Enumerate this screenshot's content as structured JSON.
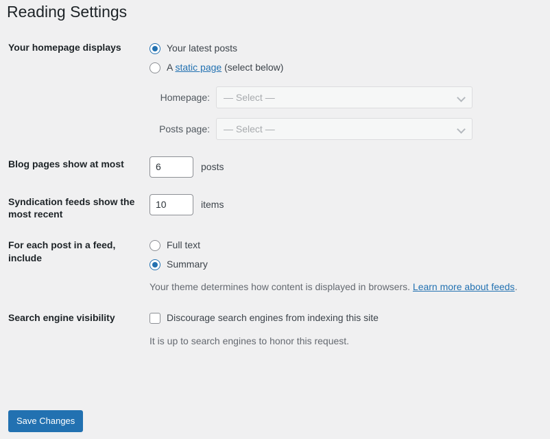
{
  "page": {
    "title": "Reading Settings"
  },
  "homepage_section": {
    "label": "Your homepage displays",
    "options": [
      {
        "label": "Your latest posts",
        "selected": true
      },
      {
        "label_prefix": "A ",
        "link_text": "static page",
        "label_suffix": " (select below)",
        "selected": false
      }
    ],
    "static_rows": [
      {
        "label": "Homepage:",
        "value": "— Select —",
        "disabled": true
      },
      {
        "label": "Posts page:",
        "value": "— Select —",
        "disabled": true
      }
    ]
  },
  "blog_pages_section": {
    "label": "Blog pages show at most",
    "value": "6",
    "unit": "posts"
  },
  "syndication_section": {
    "label": "Syndication feeds show the most recent",
    "value": "10",
    "unit": "items"
  },
  "feed_include_section": {
    "label": "For each post in a feed, include",
    "options": [
      {
        "label": "Full text",
        "selected": false
      },
      {
        "label": "Summary",
        "selected": true
      }
    ],
    "description_prefix": "Your theme determines how content is displayed in browsers. ",
    "description_link": "Learn more about feeds",
    "description_suffix": "."
  },
  "visibility_section": {
    "label": "Search engine visibility",
    "checkbox_label": "Discourage search engines from indexing this site",
    "checked": false,
    "description": "It is up to search engines to honor this request."
  },
  "submit": {
    "save_label": "Save Changes"
  },
  "colors": {
    "accent": "#2271b1",
    "background": "#f0f0f1",
    "heading": "#1d2327",
    "muted": "#646970"
  }
}
